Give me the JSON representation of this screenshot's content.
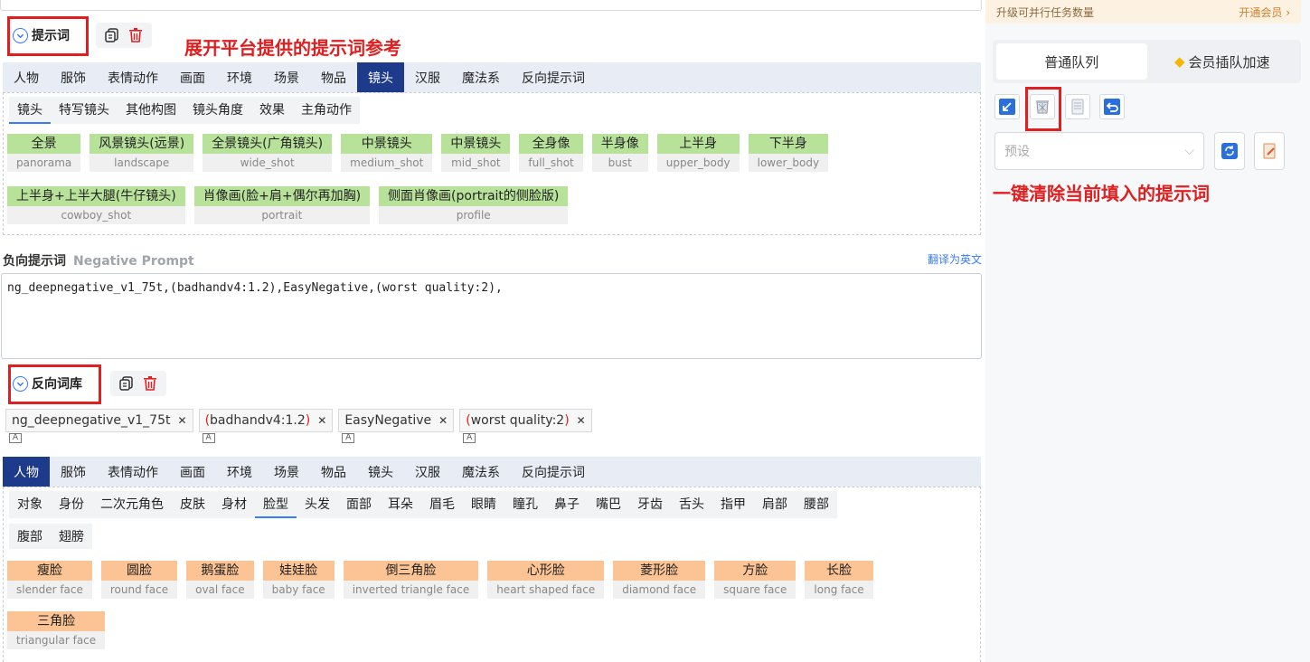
{
  "prompt_section": {
    "title": "提示词",
    "annotation": "展开平台提供的提示词参考",
    "tabs": [
      "人物",
      "服饰",
      "表情动作",
      "画面",
      "环境",
      "场景",
      "物品",
      "镜头",
      "汉服",
      "魔法系",
      "反向提示词"
    ],
    "active_tab": "镜头",
    "subtabs": [
      "镜头",
      "特写镜头",
      "其他构图",
      "镜头角度",
      "效果",
      "主角动作"
    ],
    "active_subtab": "镜头",
    "chips_row1": [
      {
        "zh": "全景",
        "en": "panorama"
      },
      {
        "zh": "风景镜头(远景)",
        "en": "landscape"
      },
      {
        "zh": "全景镜头(广角镜头)",
        "en": "wide_shot"
      },
      {
        "zh": "中景镜头",
        "en": "medium_shot"
      },
      {
        "zh": "中景镜头",
        "en": "mid_shot"
      },
      {
        "zh": "全身像",
        "en": "full_shot"
      },
      {
        "zh": "半身像",
        "en": "bust"
      },
      {
        "zh": "上半身",
        "en": "upper_body"
      },
      {
        "zh": "下半身",
        "en": "lower_body"
      }
    ],
    "chips_row2": [
      {
        "zh": "上半身+上半大腿(牛仔镜头)",
        "en": "cowboy_shot"
      },
      {
        "zh": "肖像画(脸+肩+偶尔再加胸)",
        "en": "portrait"
      },
      {
        "zh": "侧面肖像画(portrait的侧脸版)",
        "en": "profile"
      }
    ]
  },
  "negative": {
    "label": "负向提示词",
    "sublabel": "Negative Prompt",
    "translate_link": "翻译为英文",
    "textarea_value": "ng_deepnegative_v1_75t,(badhandv4:1.2),EasyNegative,(worst quality:2),"
  },
  "negative_library": {
    "title": "反向词库",
    "tags": [
      {
        "pre": "",
        "paren": "",
        "text": "ng_deepnegative_v1_75t",
        "close": ""
      },
      {
        "pre": "(",
        "text": "badhandv4:1.2",
        "close": ")"
      },
      {
        "pre": "",
        "text": "EasyNegative",
        "close": ""
      },
      {
        "pre": "(",
        "text": "worst quality:2",
        "close": ")"
      }
    ],
    "tabs": [
      "人物",
      "服饰",
      "表情动作",
      "画面",
      "环境",
      "场景",
      "物品",
      "镜头",
      "汉服",
      "魔法系",
      "反向提示词"
    ],
    "active_tab": "人物",
    "subtabs": [
      "对象",
      "身份",
      "二次元角色",
      "皮肤",
      "身材",
      "脸型",
      "头发",
      "面部",
      "耳朵",
      "眉毛",
      "眼睛",
      "瞳孔",
      "鼻子",
      "嘴巴",
      "牙齿",
      "舌头",
      "指甲",
      "肩部",
      "腰部"
    ],
    "subtabs_row2": [
      "腹部",
      "翅膀"
    ],
    "active_subtab": "脸型",
    "chips_row1": [
      {
        "zh": "瘦脸",
        "en": "slender face"
      },
      {
        "zh": "圆脸",
        "en": "round face"
      },
      {
        "zh": "鹅蛋脸",
        "en": "oval face"
      },
      {
        "zh": "娃娃脸",
        "en": "baby face"
      },
      {
        "zh": "倒三角脸",
        "en": "inverted triangle face"
      },
      {
        "zh": "心形脸",
        "en": "heart shaped face"
      },
      {
        "zh": "菱形脸",
        "en": "diamond face"
      },
      {
        "zh": "方脸",
        "en": "square face"
      },
      {
        "zh": "长脸",
        "en": "long face"
      }
    ],
    "chips_row2": [
      {
        "zh": "三角脸",
        "en": "triangular face"
      }
    ]
  },
  "sidebar": {
    "promo_left": "升级可并行任务数量",
    "promo_right": "开通会员 ›",
    "queue_normal": "普通队列",
    "queue_vip": "会员插队加速",
    "preset_placeholder": "预设",
    "annotation": "一键清除当前填入的提示词"
  },
  "colors": {
    "accent": "#3a7afe",
    "active_tab_bg": "#1e3a8a",
    "chip_green": "#b8e29a",
    "chip_orange": "#fcc494",
    "annotation_red": "#e02020"
  }
}
